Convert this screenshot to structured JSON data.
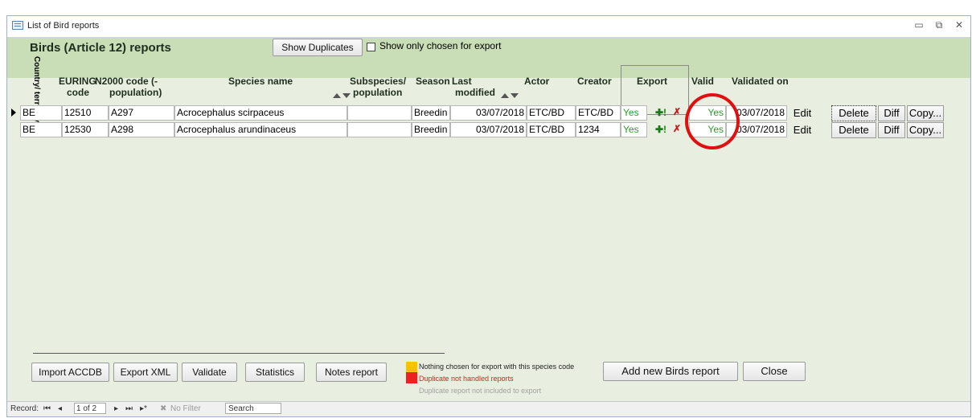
{
  "window": {
    "title": "List of Bird reports",
    "minimize": "▭",
    "restore": "⧉",
    "close": "✕"
  },
  "header": {
    "title": "Birds (Article 12) reports",
    "show_duplicates": "Show Duplicates",
    "show_only_chosen": "Show only chosen for export"
  },
  "columns": {
    "country": "Country/ territory",
    "euring_1": "EURING",
    "euring_2": "code",
    "n2000_1": "N2000 code (-",
    "n2000_2": "population)",
    "species": "Species name",
    "subspecies_1": "Subspecies/",
    "subspecies_2": "population",
    "season": "Season",
    "last_1": "Last",
    "last_2": "modified",
    "actor": "Actor",
    "creator": "Creator",
    "export": "Export",
    "valid": "Valid",
    "validated_on": "Validated on"
  },
  "rows": [
    {
      "country": "BE",
      "euring": "12510",
      "n2000": "A297",
      "species": "Acrocephalus scirpaceus",
      "subspecies": "",
      "season": "Breedin",
      "last_modified": "03/07/2018",
      "actor": "ETC/BD",
      "creator": "ETC/BD",
      "export": "Yes",
      "plus": "✚!",
      "cross": "✗",
      "valid": "Yes",
      "validated_on": "03/07/2018",
      "edit": "Edit",
      "delete": "Delete",
      "diff": "Diff",
      "copy": "Copy..."
    },
    {
      "country": "BE",
      "euring": "12530",
      "n2000": "A298",
      "species": "Acrocephalus arundinaceus",
      "subspecies": "",
      "season": "Breedin",
      "last_modified": "03/07/2018",
      "actor": "ETC/BD",
      "creator": "1234",
      "export": "Yes",
      "plus": "✚!",
      "cross": "✗",
      "valid": "Yes",
      "validated_on": "03/07/2018",
      "edit": "Edit",
      "delete": "Delete",
      "diff": "Diff",
      "copy": "Copy..."
    }
  ],
  "footer": {
    "import_accdb": "Import ACCDB",
    "export_xml": "Export XML",
    "validate": "Validate",
    "statistics": "Statistics",
    "notes_report": "Notes report",
    "add_new": "Add new Birds report",
    "close": "Close",
    "legend": [
      {
        "text": "Nothing chosen for export with this species  code",
        "color": "#ffc000"
      },
      {
        "text": "Duplicate not handled reports",
        "color": "#ee2020"
      },
      {
        "text": "Duplicate report not included to export",
        "color": "#bbbbbb"
      }
    ]
  },
  "status": {
    "record_label": "Record:",
    "first": "⏮",
    "prev": "◂",
    "position": "1 of 2",
    "next": "▸",
    "last": "⏭",
    "new": "▸*",
    "no_filter": "No Filter",
    "search": "Search"
  },
  "colors": {
    "header_bg": "#c9deb6",
    "body_bg": "#e8efe0",
    "green_text": "#2e9a2e",
    "highlight_circle": "#e01010"
  }
}
